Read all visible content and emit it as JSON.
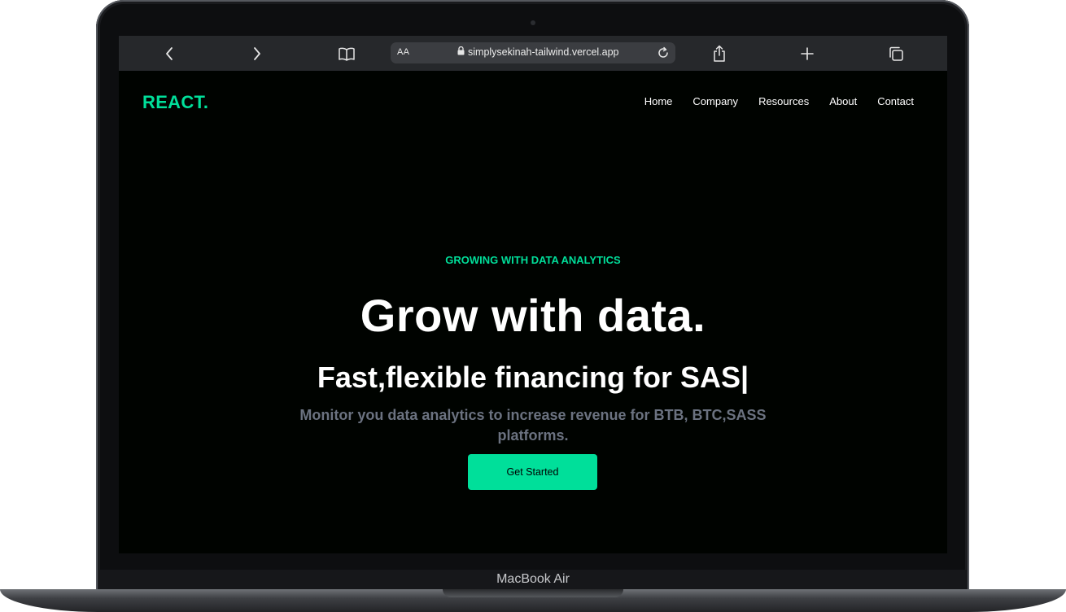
{
  "browser": {
    "url_prefix": "AA",
    "url": "simplysekinah-tailwind.vercel.app",
    "icons": [
      "back-icon",
      "forward-icon",
      "bookmarks-icon",
      "lock-icon",
      "reload-icon",
      "share-icon",
      "new-tab-icon",
      "tabs-icon"
    ]
  },
  "site": {
    "logo": "REACT.",
    "nav": [
      "Home",
      "Company",
      "Resources",
      "About",
      "Contact"
    ]
  },
  "hero": {
    "eyebrow": "GROWING WITH DATA ANALYTICS",
    "headline": "Grow with data.",
    "subhead": "Fast,flexible financing for SAS|",
    "description": "Monitor you data analytics to increase revenue for BTB, BTC,SASS platforms.",
    "cta_label": "Get Started"
  },
  "device": {
    "label": "MacBook Air"
  },
  "colors": {
    "accent": "#00df9a",
    "page_background": "#000300",
    "muted_text": "#6b7280"
  }
}
